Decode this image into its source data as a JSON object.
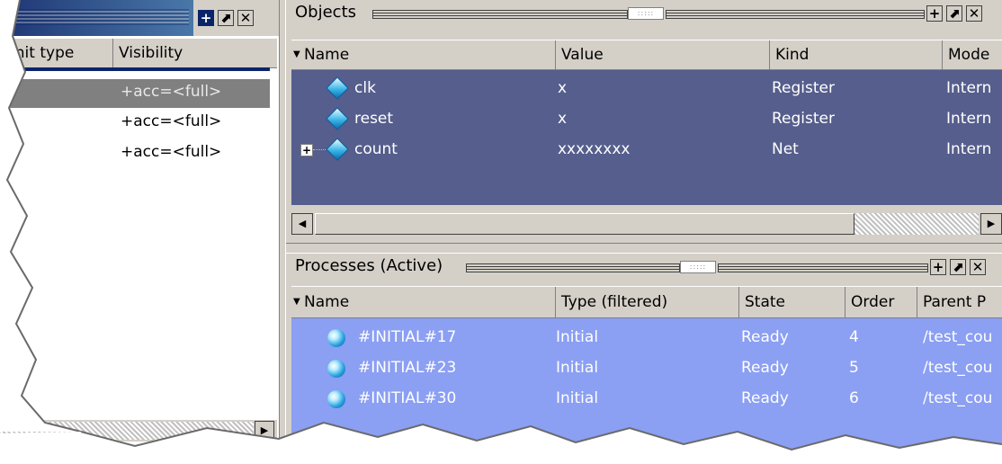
{
  "left_panel": {
    "columns": [
      "unit type",
      "Visibility"
    ],
    "rows": [
      {
        "visibility": "+acc=<full>",
        "selected": true
      },
      {
        "visibility": "+acc=<full>",
        "selected": false
      },
      {
        "visibility": "+acc=<full>",
        "selected": false
      }
    ],
    "title_buttons": [
      "+",
      "⬈",
      "✕"
    ]
  },
  "objects": {
    "title": "Objects",
    "grip": ":::::",
    "columns": [
      "Name",
      "Value",
      "Kind",
      "Mode"
    ],
    "rows": [
      {
        "name": "clk",
        "value": "x",
        "kind": "Register",
        "mode": "Intern",
        "expandable": false
      },
      {
        "name": "reset",
        "value": "x",
        "kind": "Register",
        "mode": "Intern",
        "expandable": false
      },
      {
        "name": "count",
        "value": "xxxxxxxx",
        "kind": "Net",
        "mode": "Intern",
        "expandable": true
      }
    ],
    "expander_symbol": "+",
    "title_buttons": [
      "+",
      "⬈",
      "✕"
    ]
  },
  "processes": {
    "title": "Processes (Active)",
    "grip": ":::::",
    "columns": [
      "Name",
      "Type (filtered)",
      "State",
      "Order",
      "Parent P"
    ],
    "rows": [
      {
        "name": "#INITIAL#17",
        "type": "Initial",
        "state": "Ready",
        "order": "4",
        "parent": "/test_cou"
      },
      {
        "name": "#INITIAL#23",
        "type": "Initial",
        "state": "Ready",
        "order": "5",
        "parent": "/test_cou"
      },
      {
        "name": "#INITIAL#30",
        "type": "Initial",
        "state": "Ready",
        "order": "6",
        "parent": "/test_cou"
      }
    ],
    "title_buttons": [
      "+",
      "⬈",
      "✕"
    ]
  },
  "scroll_arrows": {
    "left": "◀",
    "right": "▶"
  },
  "colors": {
    "objects_selection": "#555e8c",
    "processes_selection": "#8b9ff3",
    "chrome": "#d4d0c8",
    "left_selected_row": "#808080"
  }
}
